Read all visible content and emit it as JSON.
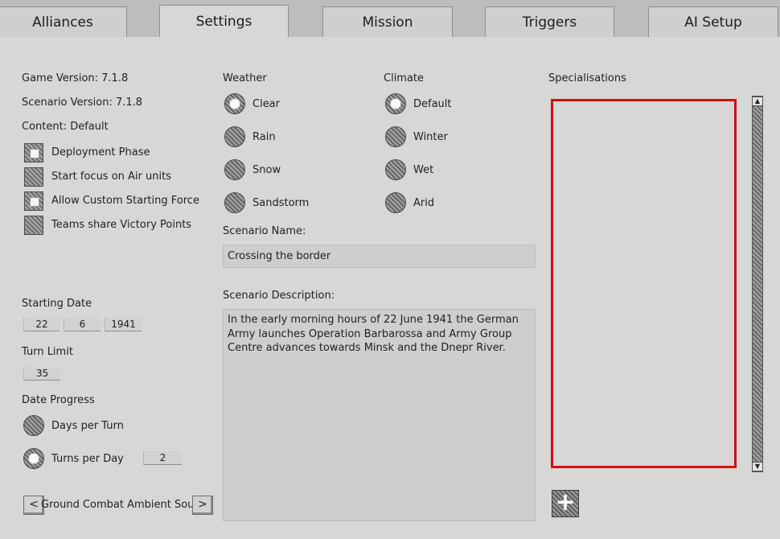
{
  "tabs": [
    "Alliances",
    "Settings",
    "Mission",
    "Triggers",
    "AI Setup"
  ],
  "info": {
    "game_version": "Game Version: 7.1.8",
    "scenario_version": "Scenario Version: 7.1.8",
    "content": "Content: Default"
  },
  "options": [
    {
      "label": "Deployment Phase",
      "checked": true
    },
    {
      "label": "Start focus on Air units",
      "checked": false
    },
    {
      "label": "Allow Custom Starting Force",
      "checked": true
    },
    {
      "label": "Teams share Victory Points",
      "checked": false
    }
  ],
  "starting_date": {
    "label": "Starting Date",
    "day": "22",
    "month": "6",
    "year": "1941"
  },
  "turn_limit": {
    "label": "Turn Limit",
    "value": "35"
  },
  "date_progress": {
    "label": "Date Progress",
    "days_per_turn": "Days per Turn",
    "turns_per_day": "Turns per Day",
    "turns_per_day_value": "2",
    "selected": "turns_per_day"
  },
  "ambient_sound": {
    "label": "Ground Combat Ambient Sound",
    "prev": "<",
    "next": ">"
  },
  "weather": {
    "label": "Weather",
    "options": [
      "Clear",
      "Rain",
      "Snow",
      "Sandstorm"
    ],
    "selected": "Clear"
  },
  "climate": {
    "label": "Climate",
    "options": [
      "Default",
      "Winter",
      "Wet",
      "Arid"
    ],
    "selected": "Default"
  },
  "scenario_name": {
    "label": "Scenario Name:",
    "value": "Crossing the border"
  },
  "scenario_description": {
    "label": "Scenario Description:",
    "value": "In the early morning hours of 22 June 1941 the German Army launches Operation Barbarossa and Army Group Centre advances towards Minsk and the Dnepr River."
  },
  "specialisations": {
    "label": "Specialisations",
    "add_icon": "plus-icon"
  },
  "colors": {
    "highlight": "#d40d12",
    "panel": "#d7d7d5"
  }
}
